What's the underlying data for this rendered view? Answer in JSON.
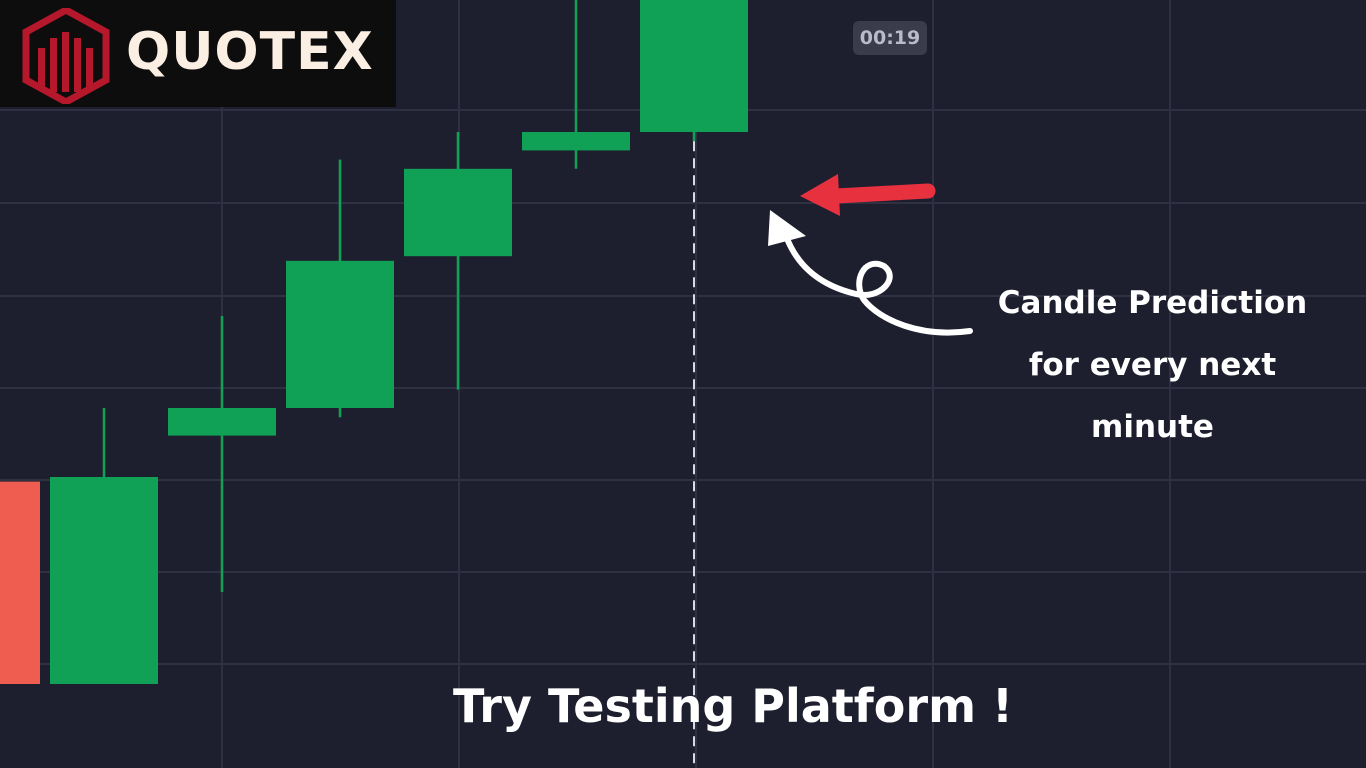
{
  "brand": {
    "name": "QUOTEX",
    "logo_icon": "quotex-shield-logo",
    "logo_color": "#b5172b",
    "text_color": "#fbeee3"
  },
  "timer": "00:19",
  "annotation": {
    "text": "Candle Prediction for every next minute"
  },
  "cta": "Try Testing Platform !",
  "colors": {
    "background": "#1e1f2e",
    "grid": "#2f3142",
    "bullish": "#10a157",
    "bearish": "#ee5d4f",
    "red_arrow": "#e7313f",
    "white_arrow": "#ffffff"
  },
  "chart_data": {
    "type": "candlestick",
    "grid": true,
    "current_price_line": "dashed",
    "time_cursor": "dashed",
    "candles": [
      {
        "index": 0,
        "direction": "bearish",
        "open": 52,
        "close": 30,
        "high": 52,
        "low": 30
      },
      {
        "index": 1,
        "direction": "bullish",
        "open": 30,
        "close": 52.5,
        "high": 60,
        "low": 30
      },
      {
        "index": 2,
        "direction": "bullish",
        "open": 57,
        "close": 60,
        "high": 70,
        "low": 40
      },
      {
        "index": 3,
        "direction": "bullish",
        "open": 60,
        "close": 76,
        "high": 87,
        "low": 59
      },
      {
        "index": 4,
        "direction": "bullish",
        "open": 76.5,
        "close": 86,
        "high": 90,
        "low": 62
      },
      {
        "index": 5,
        "direction": "bullish",
        "open": 88,
        "close": 90,
        "high": 106,
        "low": 86
      },
      {
        "index": 6,
        "direction": "bullish",
        "open": 90,
        "close": 111,
        "high": 114,
        "low": 89
      }
    ]
  }
}
